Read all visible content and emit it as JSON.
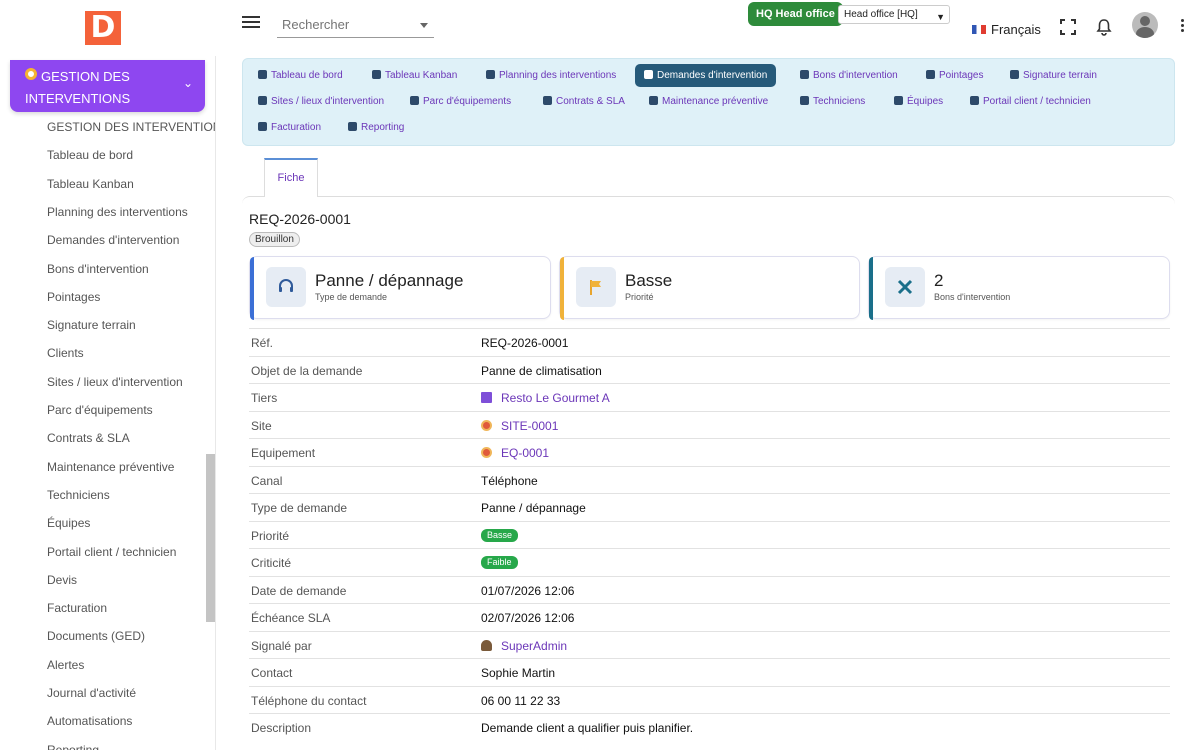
{
  "brand": {
    "logo_letter": "D",
    "accent": "#8e47f0",
    "logo_color": "#f4623a"
  },
  "search": {
    "placeholder": "Rechercher"
  },
  "entity": {
    "badge": "HQ Head office",
    "select_value": "Head office [HQ]"
  },
  "language": {
    "label": "Français"
  },
  "sidebar": {
    "header": "GESTION DES INTERVENTIONS",
    "items": [
      {
        "label": "GESTION DES INTERVENTIONS"
      },
      {
        "label": "Tableau de bord"
      },
      {
        "label": "Tableau Kanban"
      },
      {
        "label": "Planning des interventions"
      },
      {
        "label": "Demandes d'intervention"
      },
      {
        "label": "Bons d'intervention"
      },
      {
        "label": "Pointages"
      },
      {
        "label": "Signature terrain"
      },
      {
        "label": "Clients"
      },
      {
        "label": "Sites / lieux d'intervention"
      },
      {
        "label": "Parc d'équipements"
      },
      {
        "label": "Contrats & SLA"
      },
      {
        "label": "Maintenance préventive"
      },
      {
        "label": "Techniciens"
      },
      {
        "label": "Équipes"
      },
      {
        "label": "Portail client / technicien"
      },
      {
        "label": "Devis"
      },
      {
        "label": "Facturation"
      },
      {
        "label": "Documents (GED)"
      },
      {
        "label": "Alertes"
      },
      {
        "label": "Journal d'activité"
      },
      {
        "label": "Automatisations"
      },
      {
        "label": "Reporting"
      }
    ]
  },
  "tabmenu": {
    "items": [
      {
        "label": "Tableau de bord",
        "icon": "dashboard-icon"
      },
      {
        "label": "Tableau Kanban",
        "icon": "kanban-icon"
      },
      {
        "label": "Planning des interventions",
        "icon": "calendar-icon"
      },
      {
        "label": "Demandes d'intervention",
        "icon": "headset-icon",
        "active": true
      },
      {
        "label": "Bons d'intervention",
        "icon": "tools-icon"
      },
      {
        "label": "Pointages",
        "icon": "clock-icon"
      },
      {
        "label": "Signature terrain",
        "icon": "signature-icon"
      },
      {
        "label": "Sites / lieux d'intervention",
        "icon": "map-pin-icon"
      },
      {
        "label": "Parc d'équipements",
        "icon": "cogs-icon"
      },
      {
        "label": "Contrats & SLA",
        "icon": "contract-icon"
      },
      {
        "label": "Maintenance préventive",
        "icon": "calendar-check-icon"
      },
      {
        "label": "Techniciens",
        "icon": "user-cog-icon"
      },
      {
        "label": "Équipes",
        "icon": "users-icon"
      },
      {
        "label": "Portail client / technicien",
        "icon": "mobile-icon"
      },
      {
        "label": "Facturation",
        "icon": "invoice-icon"
      },
      {
        "label": "Reporting",
        "icon": "pie-chart-icon"
      }
    ]
  },
  "record": {
    "tab": "Fiche",
    "ref": "REQ-2026-0001",
    "status": "Brouillon",
    "kpis": [
      {
        "value": "Panne / dépannage",
        "label": "Type de demande",
        "color": "#3b6fd6",
        "icon": "headset-icon"
      },
      {
        "value": "Basse",
        "label": "Priorité",
        "color": "#f0b23a",
        "icon": "flag-icon"
      },
      {
        "value": "2",
        "label": "Bons d'intervention",
        "color": "#1a6f8a",
        "icon": "tools-icon"
      }
    ],
    "fields": [
      {
        "key": "Réf.",
        "value": "REQ-2026-0001"
      },
      {
        "key": "Objet de la demande",
        "value": "Panne de climatisation"
      },
      {
        "key": "Tiers",
        "value": "Resto Le Gourmet A"
      },
      {
        "key": "Site",
        "value": "SITE-0001"
      },
      {
        "key": "Equipement",
        "value": "EQ-0001"
      },
      {
        "key": "Canal",
        "value": "Téléphone"
      },
      {
        "key": "Type de demande",
        "value": "Panne / dépannage"
      },
      {
        "key": "Priorité",
        "value": "Basse"
      },
      {
        "key": "Criticité",
        "value": "Faible"
      },
      {
        "key": "Date de demande",
        "value": "01/07/2026 12:06"
      },
      {
        "key": "Échéance SLA",
        "value": "02/07/2026 12:06"
      },
      {
        "key": "Signalé par",
        "value": "SuperAdmin"
      },
      {
        "key": "Contact",
        "value": "Sophie Martin"
      },
      {
        "key": "Téléphone du contact",
        "value": "06 00 11 22 33"
      },
      {
        "key": "Description",
        "value": "Demande client a qualifier puis planifier."
      }
    ]
  }
}
